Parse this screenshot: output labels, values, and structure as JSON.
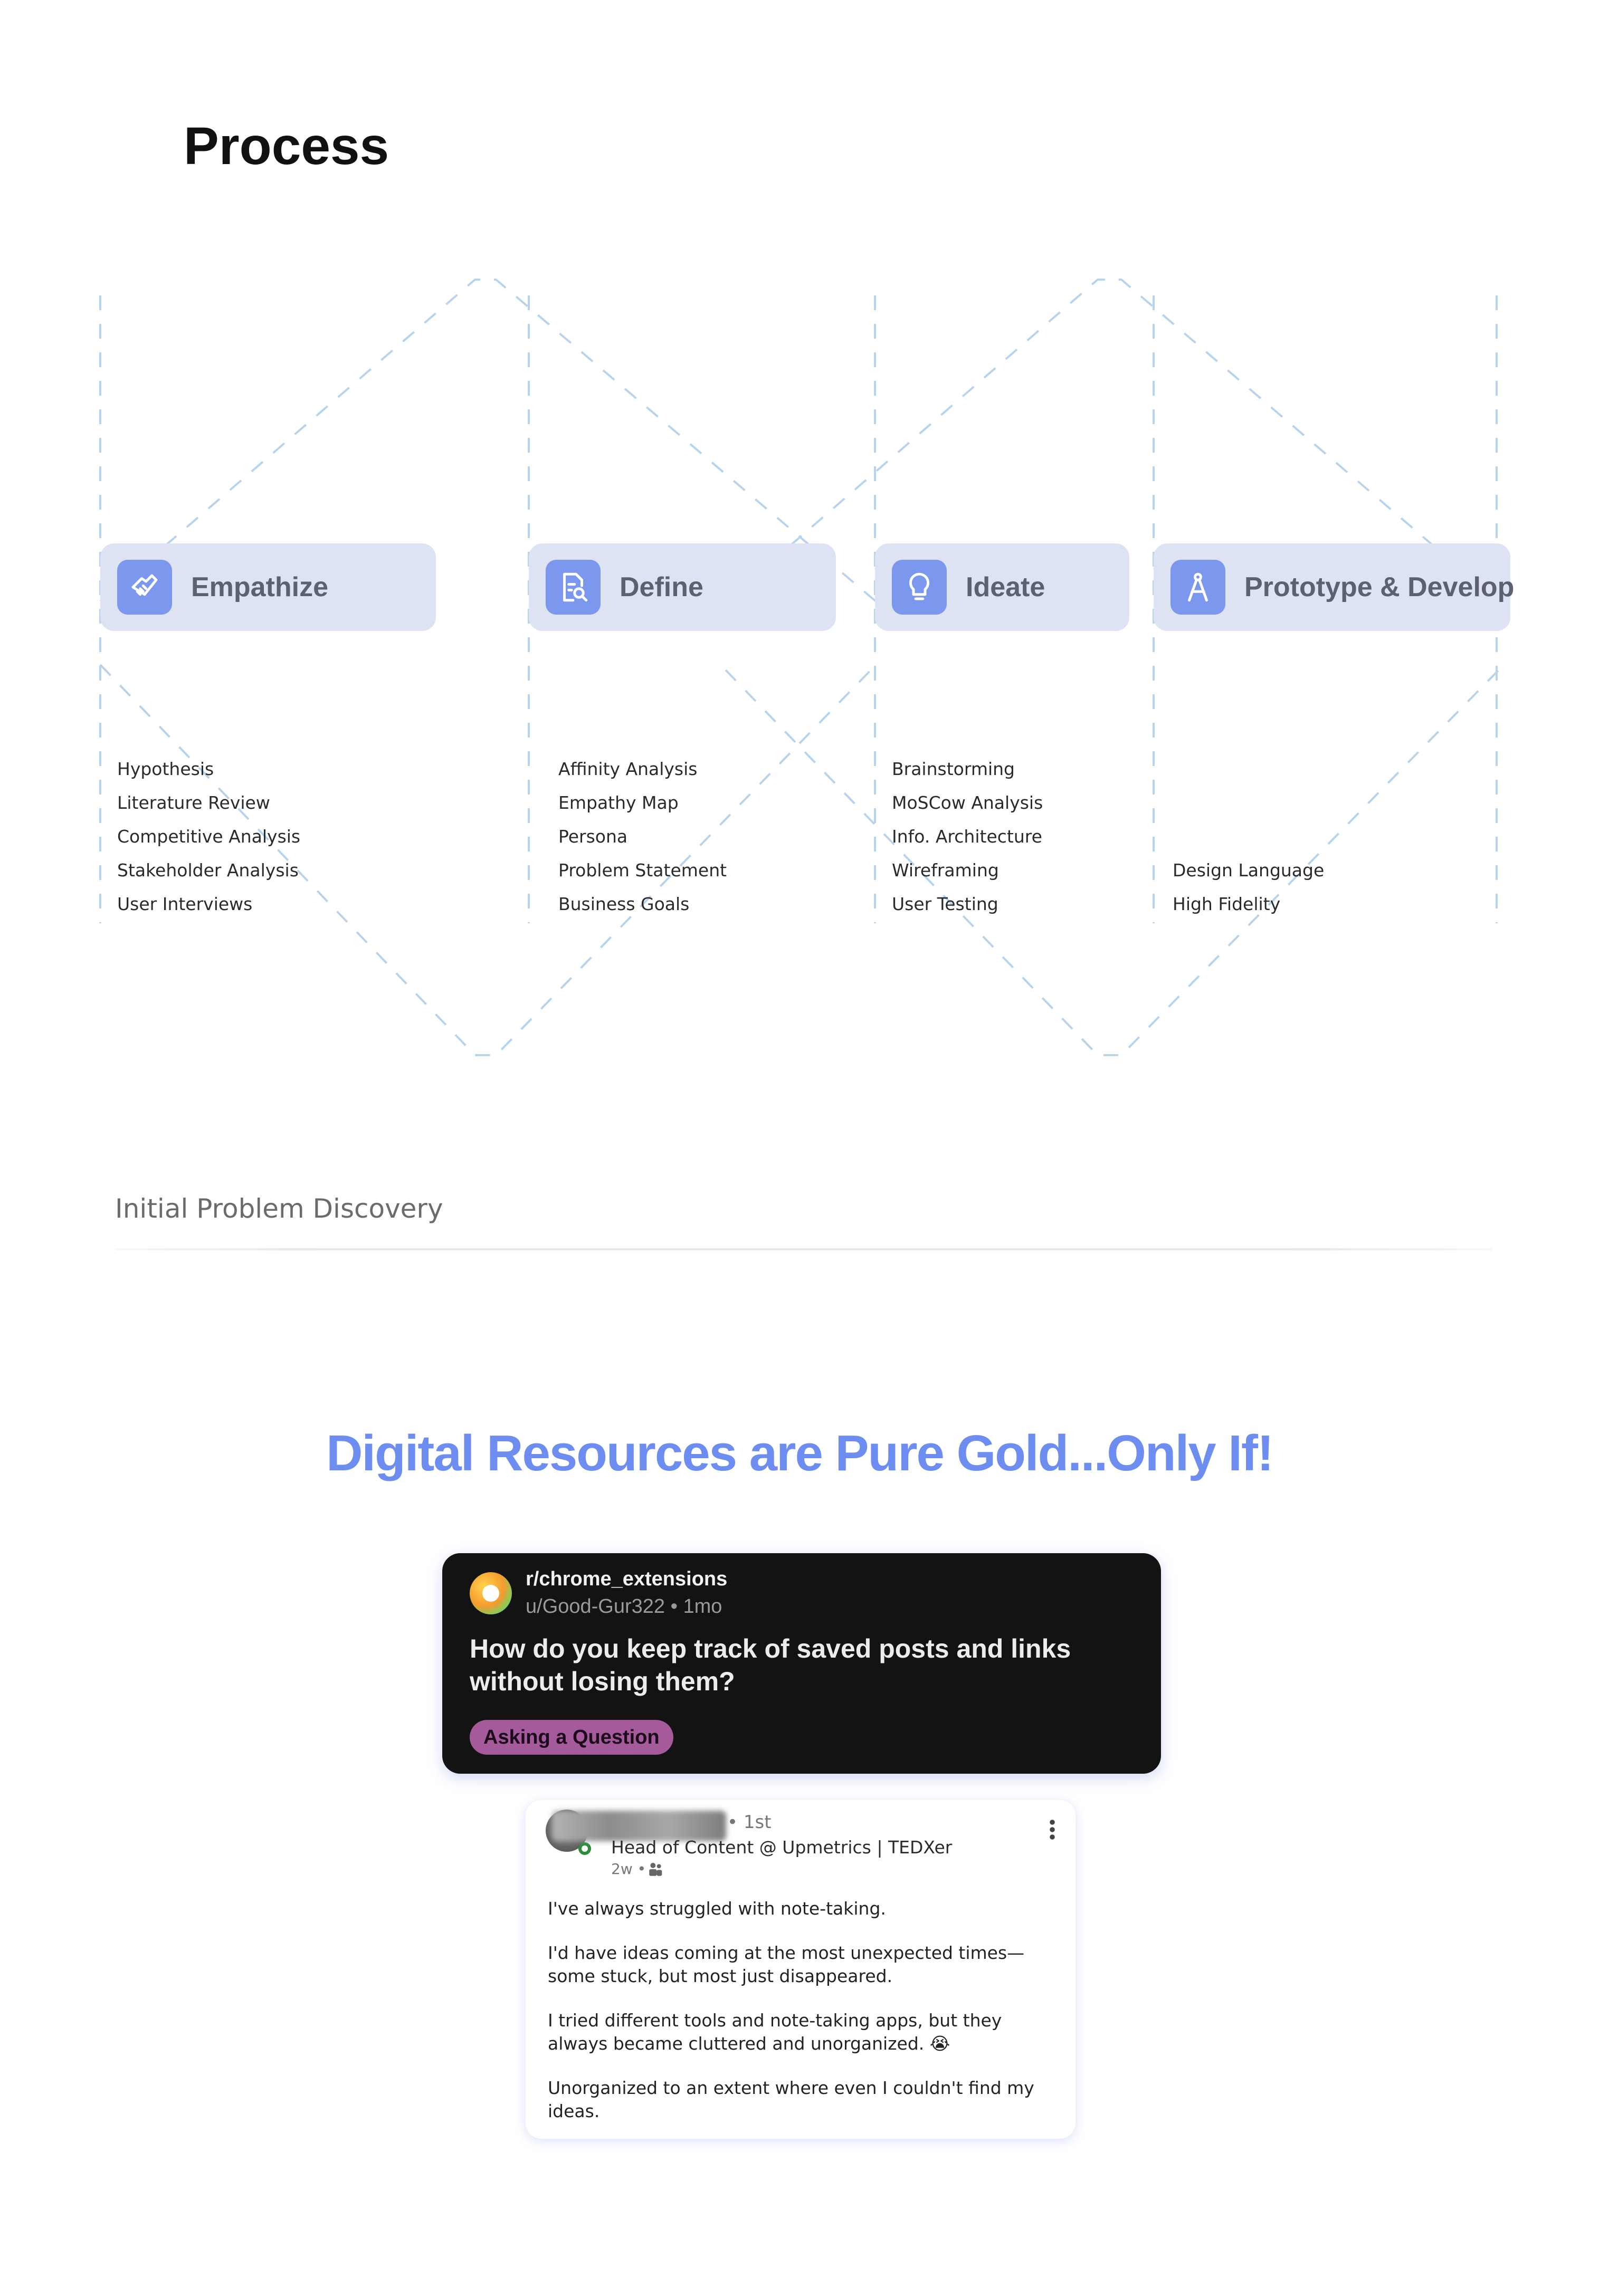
{
  "page": {
    "title": "Process"
  },
  "phases": [
    {
      "label": "Empathize",
      "icon": "handshake-icon",
      "items": [
        "Hypothesis",
        "Literature Review",
        "Competitive Analysis",
        "Stakeholder Analysis",
        "User Interviews"
      ]
    },
    {
      "label": "Define",
      "icon": "document-search-icon",
      "items": [
        "Affinity Analysis",
        "Empathy Map",
        "Persona",
        "Problem Statement",
        "Business Goals"
      ]
    },
    {
      "label": "Ideate",
      "icon": "lightbulb-icon",
      "items": [
        "Brainstorming",
        "MoSCow Analysis",
        "Info. Architecture",
        "Wireframing",
        "User Testing"
      ]
    },
    {
      "label": "Prototype & Develop",
      "icon": "compass-icon",
      "items": [
        "Design Language",
        "High Fidelity"
      ]
    }
  ],
  "section": {
    "label": "Initial Problem Discovery"
  },
  "headline": "Digital Resources are Pure Gold...Only If!",
  "reddit_post": {
    "subreddit": "r/chrome_extensions",
    "meta": "u/Good-Gur322 • 1mo",
    "title": "How do you keep track of saved posts and links without losing them?",
    "flair": "Asking a Question",
    "icon": "subreddit-avatar-icon"
  },
  "linkedin_post": {
    "degree": "• 1st",
    "headline": "Head of Content @ Upmetrics | TEDXer",
    "time": "2w •",
    "paragraphs": [
      "I've always struggled with note-taking.",
      "I'd have ideas coming at the most unexpected times—some stuck, but most just disappeared.",
      "I tried different tools and note-taking apps, but they always became cluttered and unorganized. 😭",
      "Unorganized to an extent where even I couldn't find my ideas."
    ]
  },
  "colors": {
    "card_bg": "#dde3f2",
    "icon_bg": "#7c97ee",
    "headline": "#6d8ef0",
    "dashes": "#b8d4ec",
    "flair": "#a45a9b"
  }
}
